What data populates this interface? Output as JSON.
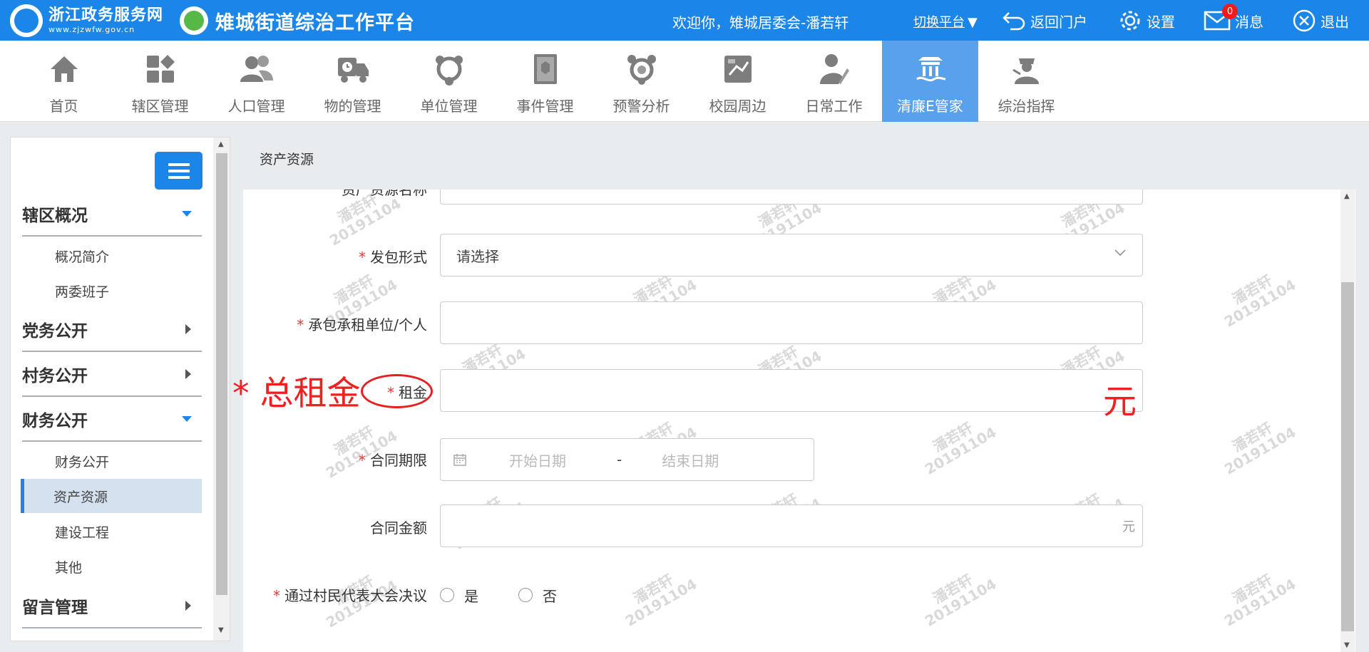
{
  "header": {
    "logo_title": "浙江政务服务网",
    "logo_url": "www.zjzwfw.gov.cn",
    "platform_title": "雉城街道综治工作平台",
    "welcome": "欢迎你，雉城居委会-潘若轩",
    "switch_platform": "切换平台",
    "back_portal": "返回门户",
    "settings": "设置",
    "messages": "消息",
    "message_count": "0",
    "logout": "退出"
  },
  "nav": {
    "items": [
      {
        "label": "首页",
        "icon": "home-icon"
      },
      {
        "label": "辖区管理",
        "icon": "grid-icon"
      },
      {
        "label": "人口管理",
        "icon": "people-icon"
      },
      {
        "label": "物的管理",
        "icon": "truck-icon"
      },
      {
        "label": "单位管理",
        "icon": "network-icon"
      },
      {
        "label": "事件管理",
        "icon": "book-icon"
      },
      {
        "label": "预警分析",
        "icon": "alert-network-icon"
      },
      {
        "label": "校园周边",
        "icon": "campus-icon"
      },
      {
        "label": "日常工作",
        "icon": "worker-icon"
      },
      {
        "label": "清廉E管家",
        "icon": "building-icon",
        "active": true
      },
      {
        "label": "综治指挥",
        "icon": "commander-icon"
      }
    ]
  },
  "sidebar": {
    "groups": [
      {
        "label": "辖区概况",
        "expanded": true,
        "subs": [
          "概况简介",
          "两委班子"
        ]
      },
      {
        "label": "党务公开",
        "expanded": false
      },
      {
        "label": "村务公开",
        "expanded": false
      },
      {
        "label": "财务公开",
        "expanded": true,
        "subs": [
          "财务公开",
          "资产资源",
          "建设工程",
          "其他"
        ],
        "active_sub": "资产资源"
      },
      {
        "label": "留言管理",
        "expanded": false
      }
    ]
  },
  "breadcrumb": "资产资源",
  "form": {
    "partial_label": "资产资源名称",
    "contract_type": {
      "label": "发包形式",
      "placeholder": "请选择"
    },
    "contractor": {
      "label": "承包承租单位/个人",
      "value": ""
    },
    "rent": {
      "label": "租金",
      "value": ""
    },
    "contract_period": {
      "label": "合同期限",
      "start_placeholder": "开始日期",
      "separator": "-",
      "end_placeholder": "结束日期"
    },
    "contract_amount": {
      "label": "合同金额",
      "unit": "元"
    },
    "resolution": {
      "label": "通过村民代表大会决议",
      "options": [
        "是",
        "否"
      ]
    }
  },
  "watermark": {
    "name": "潘若轩",
    "date": "20191104"
  },
  "annotations": {
    "total_rent": "* 总租金",
    "yuan": "元"
  },
  "colors": {
    "brand": "#1b86e8",
    "active_nav": "#5aa1ec",
    "required": "#e53935",
    "annotation": "#f02020"
  }
}
